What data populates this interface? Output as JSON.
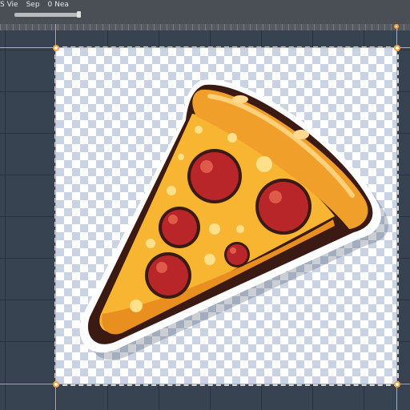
{
  "menu": {
    "items": [
      "S Vie",
      "Sep",
      "0 Nea"
    ]
  },
  "canvas": {
    "artwork": "pizza-slice-sticker",
    "background": "transparency-checkerboard"
  },
  "colors": {
    "guide": "#f2a23a",
    "workspace": "#384352",
    "crust": "#f0a02a",
    "cheese": "#f7b531",
    "pepperoni": "#b8262a",
    "outline": "#3a1a12"
  },
  "icons": [
    "transform-handle"
  ]
}
